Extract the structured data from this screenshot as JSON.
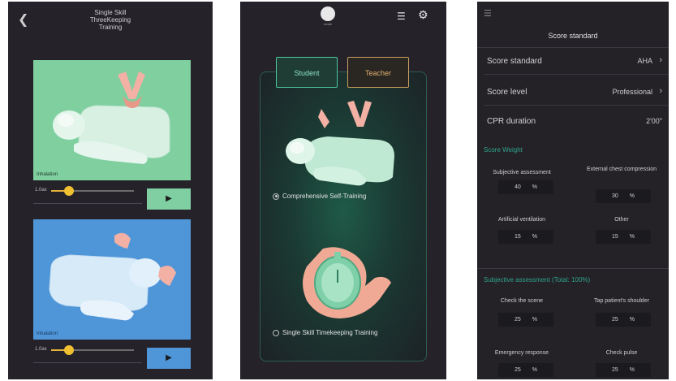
{
  "phone1": {
    "title": "Single Skill\nThreeKeeping\nTraining",
    "card1_label": "Inhalation",
    "card2_label": "Inhalation",
    "speed_label_1": "1.0ax",
    "speed_label_2": "1.0ax",
    "slider1_level": 0.22,
    "slider2_level": 0.22,
    "play_label": "▶",
    "colors": {
      "green": "#7fcf9f",
      "blue": "#4f96d8",
      "knob": "#f0c030"
    }
  },
  "phone2": {
    "logo_sub": "mode",
    "tab_student": "Student",
    "tab_teacher": "Teacher",
    "option1": "Comprehensive Self-Training",
    "option2": "Single Skill Timekeeping Training",
    "colors": {
      "student": "#4ec9a0",
      "teacher": "#c8a060"
    }
  },
  "phone3": {
    "title": "Score standard",
    "rows": [
      {
        "label": "Score standard",
        "value": "AHA"
      },
      {
        "label": "Score level",
        "value": "Professional"
      },
      {
        "label": "CPR duration",
        "value": "2'00\""
      }
    ],
    "weight_title": "Score Weight",
    "weights": [
      {
        "label": "Subjective assessment",
        "value": "40",
        "unit": "%"
      },
      {
        "label": "External chest compression",
        "value": "30",
        "unit": "%"
      },
      {
        "label": "Artificial ventilation",
        "value": "15",
        "unit": "%"
      },
      {
        "label": "Other",
        "value": "15",
        "unit": "%"
      }
    ],
    "subj_title": "Subjective assessment  (Total: 100%)",
    "subj": [
      {
        "label": "Check the scene",
        "value": "25",
        "unit": "%"
      },
      {
        "label": "Tap patient's shoulder",
        "value": "25",
        "unit": "%"
      },
      {
        "label": "Emergency response",
        "value": "25",
        "unit": "%"
      },
      {
        "label": "Check pulse",
        "value": "25",
        "unit": "%"
      }
    ],
    "accent": "#2fa58a"
  }
}
